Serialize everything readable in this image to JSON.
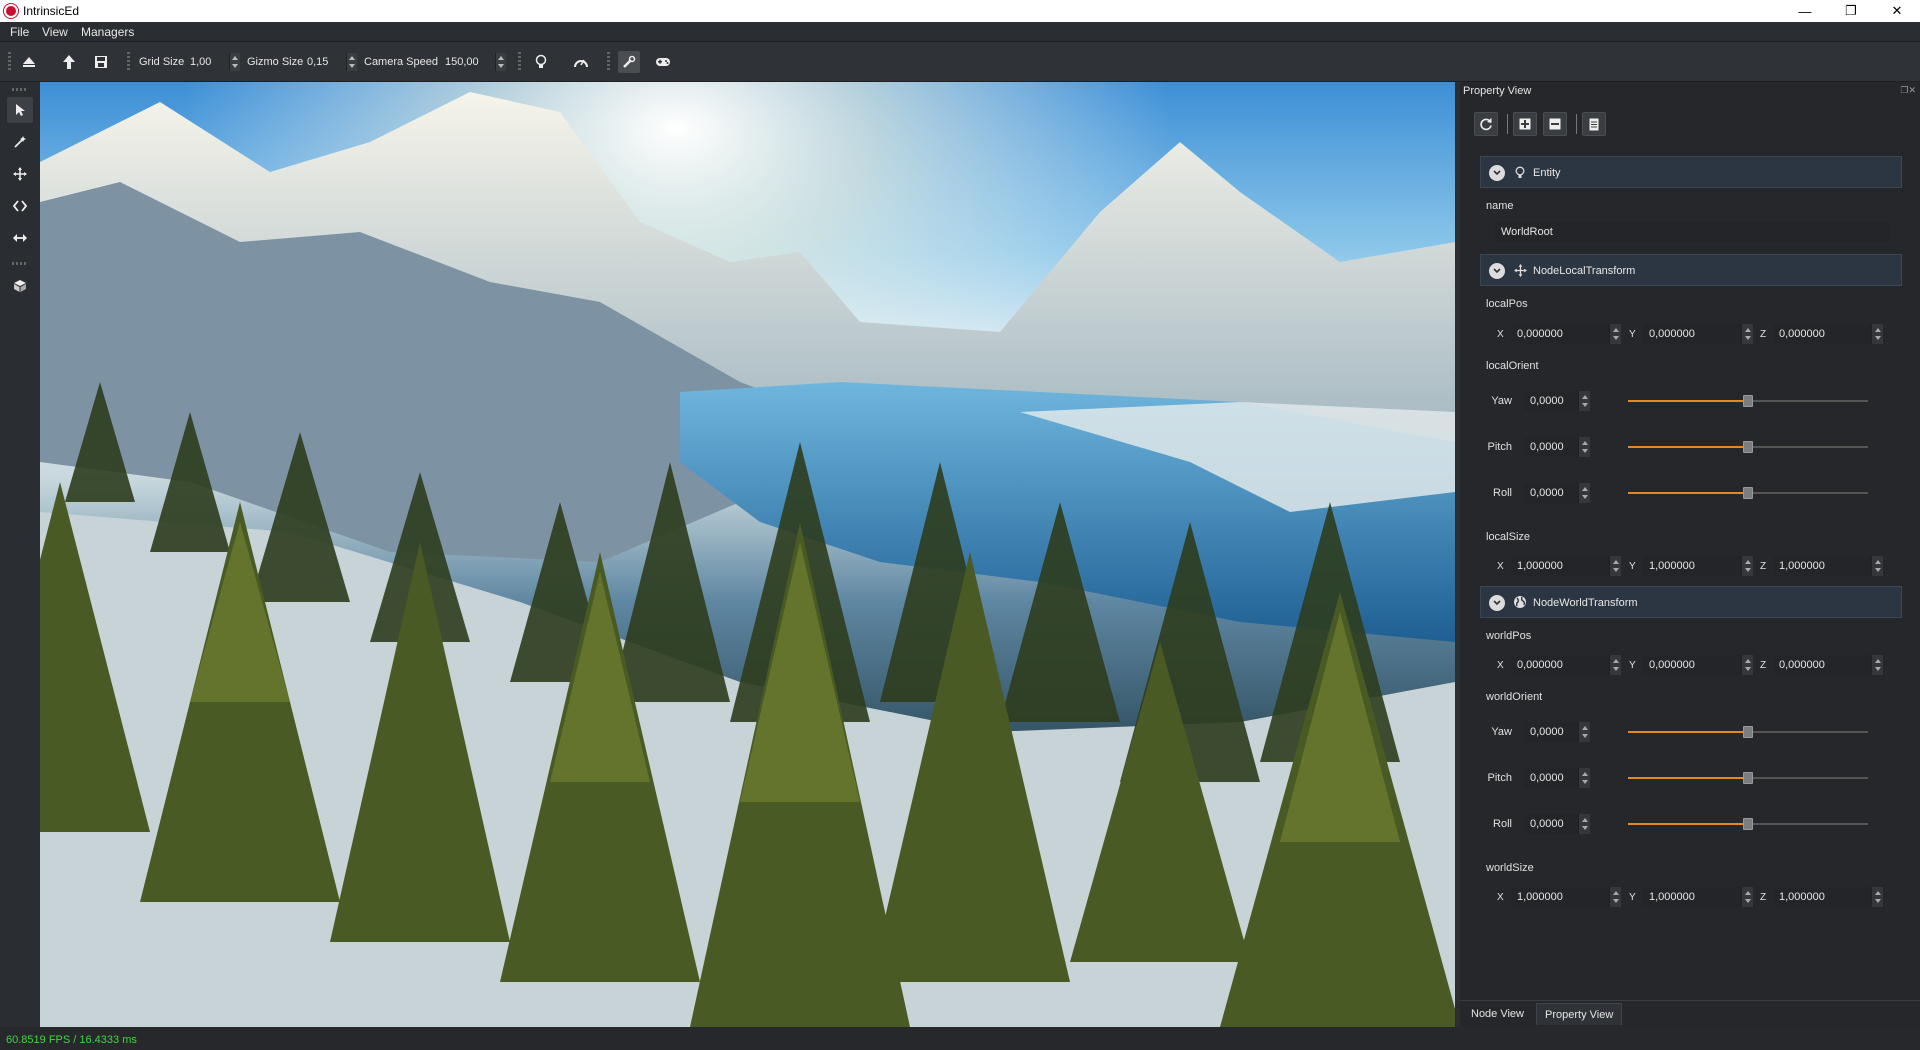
{
  "window": {
    "title": "IntrinsicEd",
    "controls": [
      "minimize-icon",
      "restore-icon",
      "close-icon"
    ]
  },
  "menu": [
    "File",
    "View",
    "Managers"
  ],
  "toolbar": {
    "grid_size_label": "Grid Size",
    "grid_size_value": "1,00",
    "gizmo_size_label": "Gizmo Size",
    "gizmo_size_value": "0,15",
    "camera_speed_label": "Camera Speed",
    "camera_speed_value": "150,00"
  },
  "status": {
    "fps": "60.8519 FPS / 16.4333 ms"
  },
  "panel": {
    "title": "Property View",
    "sections": {
      "entity": {
        "title": "Entity",
        "name_label": "name",
        "name_value": "WorldRoot"
      },
      "local": {
        "title": "NodeLocalTransform",
        "pos_label": "localPos",
        "pos": {
          "x": "0,000000",
          "y": "0,000000",
          "z": "0,000000"
        },
        "orient_label": "localOrient",
        "yaw_label": "Yaw",
        "yaw": "0,0000",
        "pitch_label": "Pitch",
        "pitch": "0,0000",
        "roll_label": "Roll",
        "roll": "0,0000",
        "size_label": "localSize",
        "size": {
          "x": "1,000000",
          "y": "1,000000",
          "z": "1,000000"
        }
      },
      "world": {
        "title": "NodeWorldTransform",
        "pos_label": "worldPos",
        "pos": {
          "x": "0,000000",
          "y": "0,000000",
          "z": "0,000000"
        },
        "orient_label": "worldOrient",
        "yaw_label": "Yaw",
        "yaw": "0,0000",
        "pitch_label": "Pitch",
        "pitch": "0,0000",
        "roll_label": "Roll",
        "roll": "0,0000",
        "size_label": "worldSize",
        "size": {
          "x": "1,000000",
          "y": "1,000000",
          "z": "1,000000"
        }
      }
    },
    "axis": {
      "x": "X",
      "y": "Y",
      "z": "Z"
    },
    "slider_level": 0.5
  },
  "bottom_tabs": [
    "Node View",
    "Property View"
  ],
  "colors": {
    "accent": "#e8891f",
    "fps_green": "#41d63d",
    "section_bg": "#2c3542"
  }
}
